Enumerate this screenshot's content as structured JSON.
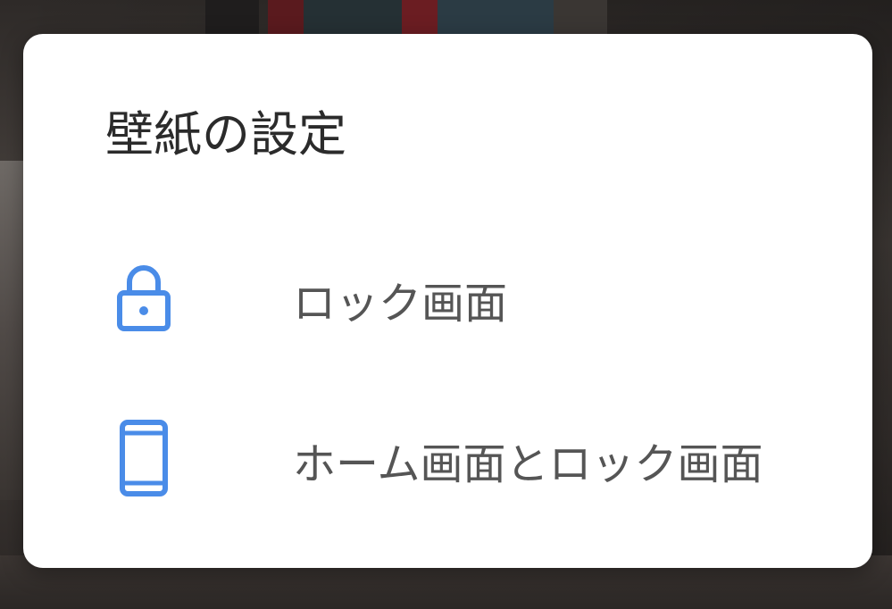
{
  "dialog": {
    "title": "壁紙の設定",
    "options": [
      {
        "label": "ロック画面",
        "icon": "lock-icon"
      },
      {
        "label": "ホーム画面とロック画面",
        "icon": "phone-icon"
      }
    ]
  },
  "colors": {
    "accent": "#4a8ce8",
    "dialog_background": "#ffffff",
    "title_text": "#2b2b2b",
    "option_text": "#555555"
  }
}
